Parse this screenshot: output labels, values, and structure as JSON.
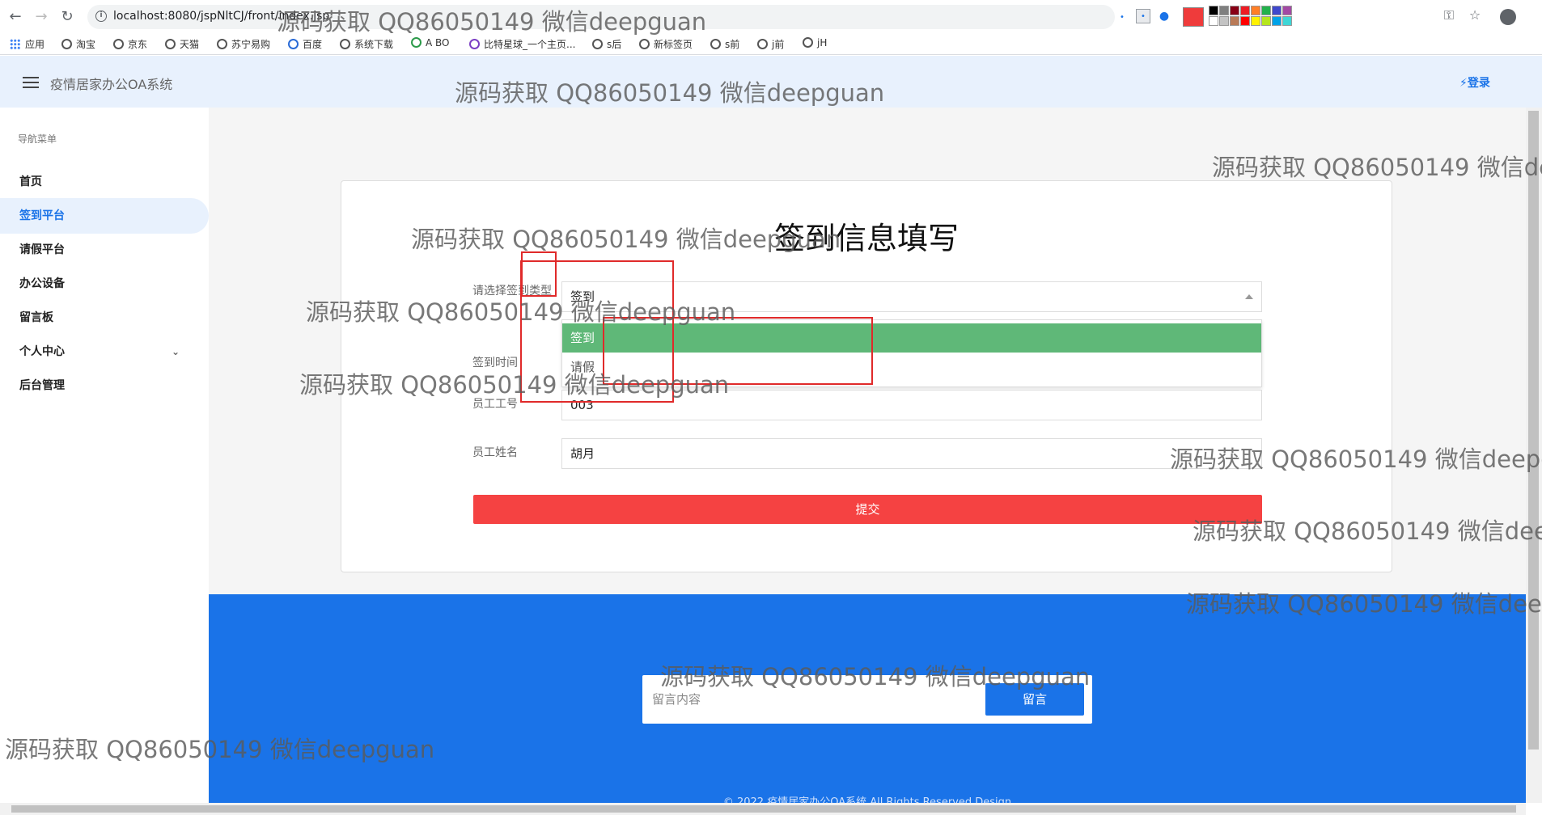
{
  "browser": {
    "url": "localhost:8080/jspNltCJ/front/index.jsp",
    "bookmarks": [
      {
        "label": "应用"
      },
      {
        "label": "淘宝"
      },
      {
        "label": "京东"
      },
      {
        "label": "天猫"
      },
      {
        "label": "苏宁易购"
      },
      {
        "label": "百度"
      },
      {
        "label": "系统下载"
      },
      {
        "label": "A BO"
      },
      {
        "label": "比特星球_一个主页..."
      },
      {
        "label": "s后"
      },
      {
        "label": "新标签页"
      },
      {
        "label": "s前"
      },
      {
        "label": "j前"
      },
      {
        "label": "jH"
      }
    ],
    "palette_colors": [
      "#000000",
      "#7f7f7f",
      "#880015",
      "#ed1c24",
      "#ff7f27",
      "#22b14c",
      "#3f48cc",
      "#a349a4",
      "#ffffff",
      "#c3c3c3",
      "#b97a57",
      "#ff0000",
      "#fff200",
      "#b5e61d",
      "#00a2e8",
      "#3fd6d6"
    ]
  },
  "header": {
    "title": "疫情居家办公OA系统",
    "login_label": "⚡登录"
  },
  "sidebar": {
    "heading": "导航菜单",
    "items": [
      {
        "label": "首页"
      },
      {
        "label": "签到平台",
        "active": true
      },
      {
        "label": "请假平台"
      },
      {
        "label": "办公设备"
      },
      {
        "label": "留言板"
      },
      {
        "label": "个人中心",
        "has_children": true
      },
      {
        "label": "后台管理"
      }
    ]
  },
  "form": {
    "title": "签到信息填写",
    "type_label": "请选择签到类型",
    "type_value": "签到",
    "type_options": [
      "签到",
      "请假"
    ],
    "time_label": "签到时间",
    "employee_id_label": "员工工号",
    "employee_id_value": "003",
    "employee_name_label": "员工姓名",
    "employee_name_value": "胡月",
    "submit_label": "提交"
  },
  "footer": {
    "message_placeholder": "留言内容",
    "message_button": "留言",
    "copyright": "© 2022 疫情居家办公OA系统 All Rights Reserved  Design"
  },
  "watermark_text": "源码获取 QQ86050149 微信deepguan",
  "colors": {
    "accent": "#1a73e8",
    "submit": "#f54242",
    "selected_option": "#5fb878",
    "header_bg": "#e8f1fd"
  }
}
